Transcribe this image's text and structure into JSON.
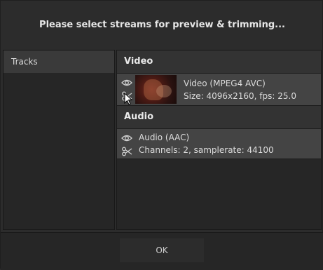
{
  "dialog": {
    "title": "Please select streams for preview & trimming..."
  },
  "tracks": {
    "header": "Tracks"
  },
  "video_section": {
    "header": "Video",
    "stream": {
      "name": "Video (MPEG4 AVC)",
      "details": "Size: 4096x2160, fps: 25.0",
      "preview_icon": "eye-icon",
      "trim_icon": "scissors-icon"
    }
  },
  "audio_section": {
    "header": "Audio",
    "stream": {
      "name": "Audio (AAC)",
      "details": "Channels: 2, samplerate: 44100",
      "preview_icon": "eye-icon",
      "trim_icon": "scissors-icon"
    }
  },
  "footer": {
    "ok_label": "OK"
  },
  "colors": {
    "background": "#2c2c2c",
    "panel": "#262626",
    "row": "#444444",
    "text": "#dcdcdc"
  }
}
